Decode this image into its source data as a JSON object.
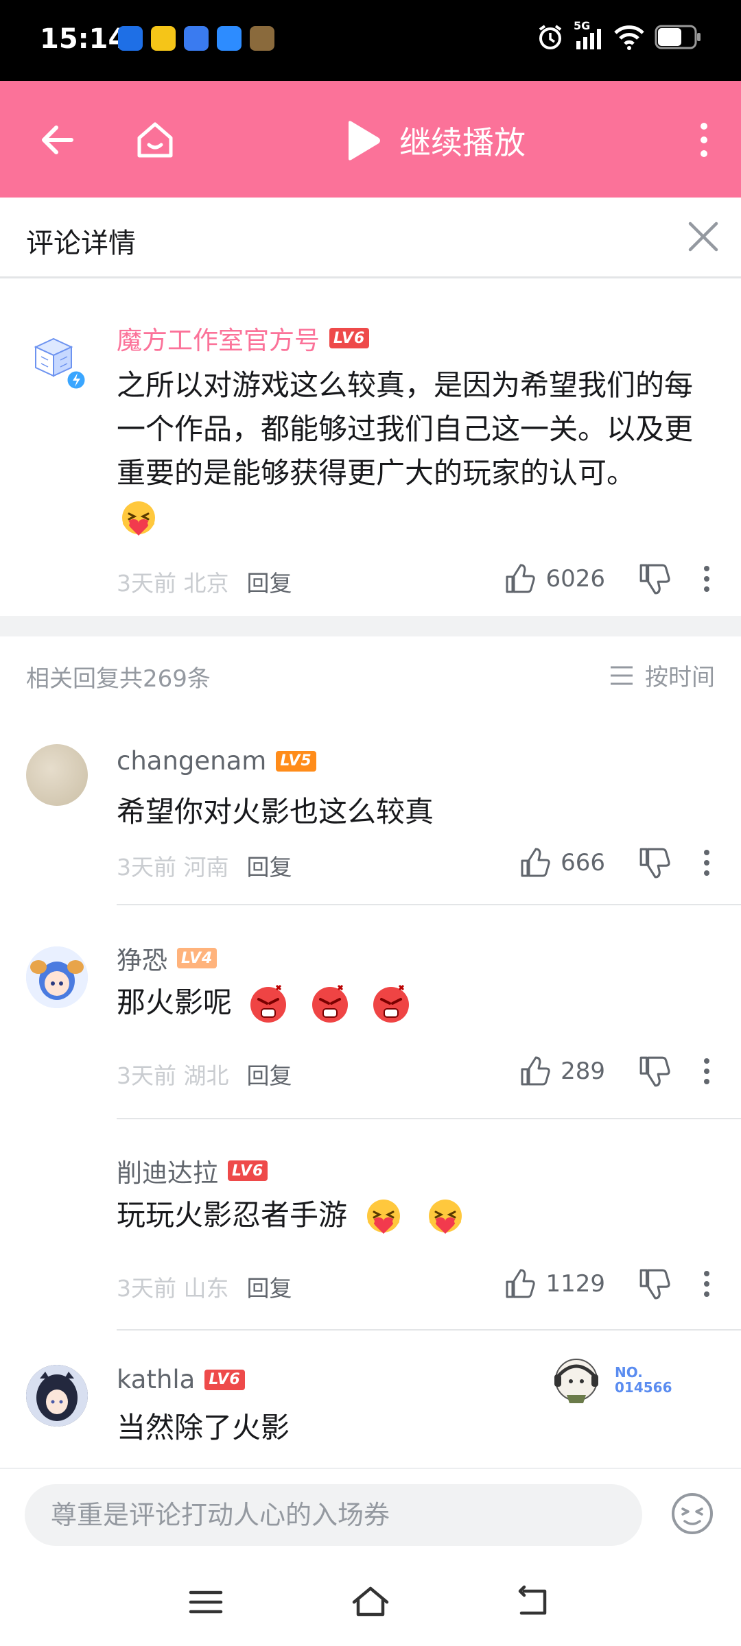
{
  "status_bar": {
    "time": "15:14",
    "network": "5G",
    "icons": [
      "alarm-icon",
      "signal-icon",
      "wifi-icon",
      "battery-icon"
    ]
  },
  "top_bar": {
    "continue_label": "继续播放",
    "accent_color": "#fb7299"
  },
  "detail": {
    "title": "评论详情"
  },
  "main_comment": {
    "username": "魔方工作室官方号",
    "level": "LV6",
    "text": "之所以对游戏这么较真，是因为希望我们的每一个作品，都能够过我们自己这一关。以及更重要的是能够获得更广大的玩家的认可。",
    "emojis": [
      "hug-heart-emoji"
    ],
    "time": "3天前",
    "location": "北京",
    "reply_label": "回复",
    "likes": "6026"
  },
  "replies_header": {
    "count_text": "相关回复共269条",
    "sort_label": "按时间"
  },
  "replies": [
    {
      "username": "changenam",
      "level": "LV5",
      "text": "希望你对火影也这么较真",
      "time": "3天前",
      "location": "河南",
      "reply_label": "回复",
      "likes": "666"
    },
    {
      "username": "狰恐",
      "level": "LV4",
      "text": "那火影呢",
      "emojis": [
        "angry-emoji",
        "angry-emoji",
        "angry-emoji"
      ],
      "time": "3天前",
      "location": "湖北",
      "reply_label": "回复",
      "likes": "289"
    },
    {
      "username": "削迪达拉",
      "level": "LV6",
      "text": "玩玩火影忍者手游",
      "emojis": [
        "hug-heart-emoji",
        "hug-heart-emoji"
      ],
      "time": "3天前",
      "location": "山东",
      "reply_label": "回复",
      "likes": "1129"
    },
    {
      "username": "kathla",
      "level": "LV6",
      "text": "当然除了火影",
      "fan_badge": "NO.\n014566"
    }
  ],
  "input": {
    "placeholder": "尊重是评论打动人心的入场券"
  },
  "nav_bar": {
    "icons": [
      "menu-icon",
      "home-icon",
      "back-icon"
    ]
  }
}
